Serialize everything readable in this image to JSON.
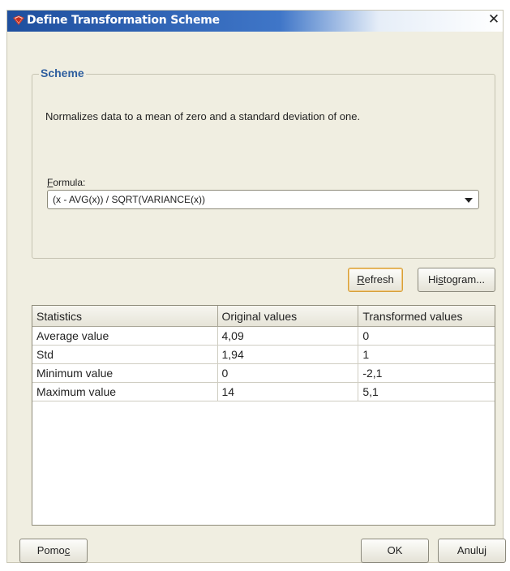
{
  "window": {
    "title": "Define Transformation Scheme",
    "icon": "app-logo-icon",
    "close_glyph": "✕"
  },
  "scheme": {
    "legend": "Scheme",
    "description": "Normalizes data to a mean of zero and a standard deviation of one.",
    "formula_label_first": "F",
    "formula_label_rest": "ormula:",
    "formula_value": "(x - AVG(x)) / SQRT(VARIANCE(x))"
  },
  "actions": {
    "refresh_first": "R",
    "refresh_rest": "efresh",
    "histogram_pre": "Hi",
    "histogram_ul": "s",
    "histogram_post": "togram..."
  },
  "stats_table": {
    "headers": [
      "Statistics",
      "Original values",
      "Transformed values"
    ],
    "rows": [
      [
        "Average value",
        "4,09",
        "0"
      ],
      [
        "Std",
        "1,94",
        "1"
      ],
      [
        "Minimum value",
        "0",
        "-2,1"
      ],
      [
        "Maximum value",
        "14",
        "5,1"
      ]
    ]
  },
  "footer": {
    "help_pre": "Pomo",
    "help_ul": "c",
    "ok": "OK",
    "cancel": "Anuluj"
  },
  "colors": {
    "title_start": "#1f4f9e",
    "legend": "#2e5e9e",
    "dialog_bg": "#f0eee1",
    "focus_border": "#d7a03a"
  }
}
